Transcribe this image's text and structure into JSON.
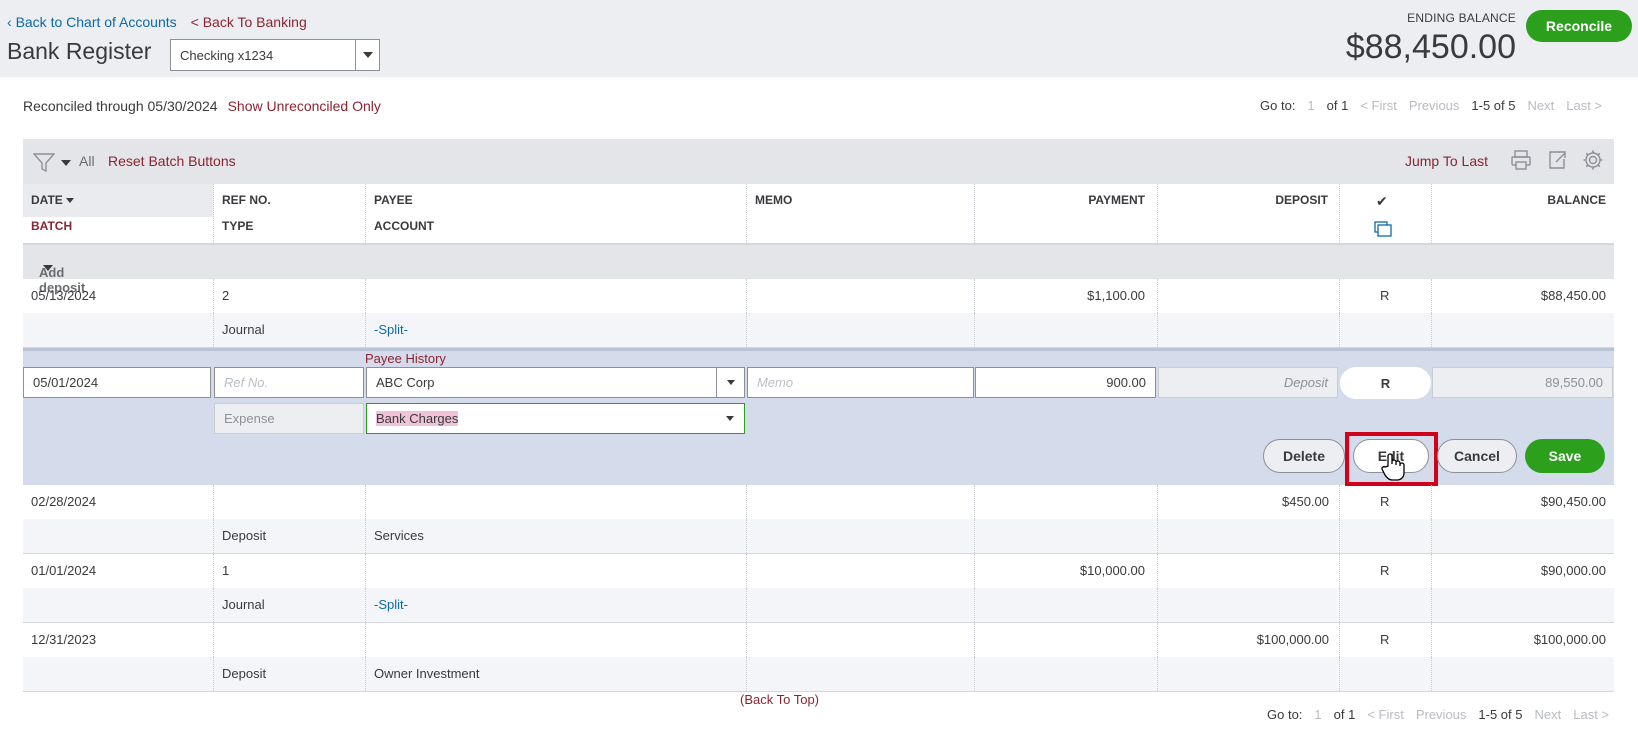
{
  "header": {
    "back_chart": "Back to Chart of Accounts",
    "back_banking": "< Back To Banking",
    "title": "Bank Register",
    "account": "Checking x1234",
    "ending_label": "ENDING BALANCE",
    "ending_amount": "$88,450.00",
    "reconcile": "Reconcile"
  },
  "reconciled": {
    "text": "Reconciled through 05/30/2024",
    "show_unreconciled": "Show Unreconciled Only"
  },
  "pager": {
    "goto": "Go to:",
    "page": "1",
    "of": "of 1",
    "first": "< First",
    "previous": "Previous",
    "range": "1-5 of 5",
    "next": "Next",
    "last": "Last >"
  },
  "toolbar": {
    "all": "All",
    "reset_batch": "Reset Batch Buttons",
    "jump_last": "Jump To Last"
  },
  "columns": {
    "date": "DATE",
    "batch": "BATCH",
    "ref": "REF NO.",
    "type": "TYPE",
    "payee": "PAYEE",
    "account": "ACCOUNT",
    "memo": "MEMO",
    "payment": "PAYMENT",
    "deposit": "DEPOSIT",
    "check": "✔",
    "balance": "BALANCE"
  },
  "add_deposit": "Add deposit",
  "rows": [
    {
      "date": "05/13/2024",
      "ref": "2",
      "type": "Journal",
      "account": "-Split-",
      "payment": "$1,100.00",
      "deposit": "",
      "status": "R",
      "balance": "$88,450.00"
    }
  ],
  "edit": {
    "payee_history": "Payee History",
    "date": "05/01/2024",
    "ref_placeholder": "Ref No.",
    "payee": "ABC Corp",
    "memo_placeholder": "Memo",
    "payment": "900.00",
    "deposit_placeholder": "Deposit",
    "status": "R",
    "balance": "89,550.00",
    "type": "Expense",
    "account": "Bank Charges",
    "delete": "Delete",
    "edit_btn": "Edit",
    "cancel": "Cancel",
    "save": "Save"
  },
  "rows_after": [
    {
      "date": "02/28/2024",
      "ref": "",
      "type": "Deposit",
      "account": "Services",
      "payment": "",
      "deposit": "$450.00",
      "status": "R",
      "balance": "$90,450.00"
    },
    {
      "date": "01/01/2024",
      "ref": "1",
      "type": "Journal",
      "account": "-Split-",
      "payment": "$10,000.00",
      "deposit": "",
      "status": "R",
      "balance": "$90,000.00"
    },
    {
      "date": "12/31/2023",
      "ref": "",
      "type": "Deposit",
      "account": "Owner Investment",
      "payment": "",
      "deposit": "$100,000.00",
      "status": "R",
      "balance": "$100,000.00"
    }
  ],
  "back_to_top": "(Back To Top)",
  "colors": {
    "green": "#2ca01c",
    "red_link": "#8d2431",
    "blue_link": "#0b6ba8",
    "highlight": "#d4dcec"
  }
}
